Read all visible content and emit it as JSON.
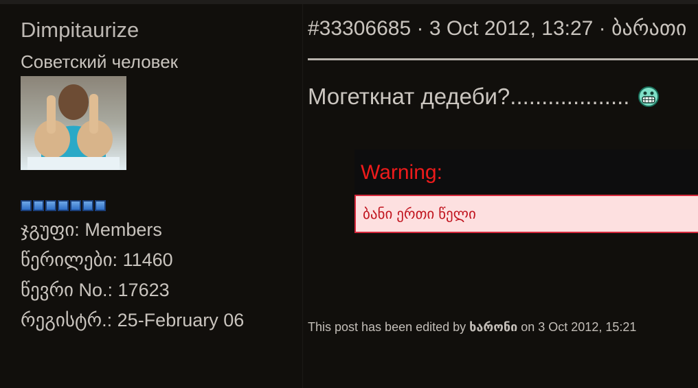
{
  "author": {
    "username": "Dimpitaurize",
    "title": "Советский человек",
    "avatar_icon": "user-avatar-photo",
    "rank_pips": 7,
    "stats": [
      {
        "label": "ჯგუფი:",
        "value": "Members"
      },
      {
        "label": "წერილები:",
        "value": "11460"
      },
      {
        "label": "წევრი No.:",
        "value": "17623"
      },
      {
        "label": "რეგისტრ.:",
        "value": "25-February 06"
      }
    ]
  },
  "post": {
    "header": "#33306685 · 3 Oct 2012, 13:27 · ბარათი",
    "text": "Могеткнат дедеби?...................",
    "emoticon": "grin-emoticon",
    "warning": {
      "title": "Warning:",
      "message": "ბანი ერთი წელი"
    },
    "edited": {
      "prefix": "This post has been edited by",
      "user": "ხარონი",
      "suffix": "on 3 Oct 2012, 15:21"
    }
  },
  "colors": {
    "background": "#110f0c",
    "text": "#c9c4be",
    "warning_red": "#ee1b1b",
    "warning_bg": "#fde0e0"
  }
}
